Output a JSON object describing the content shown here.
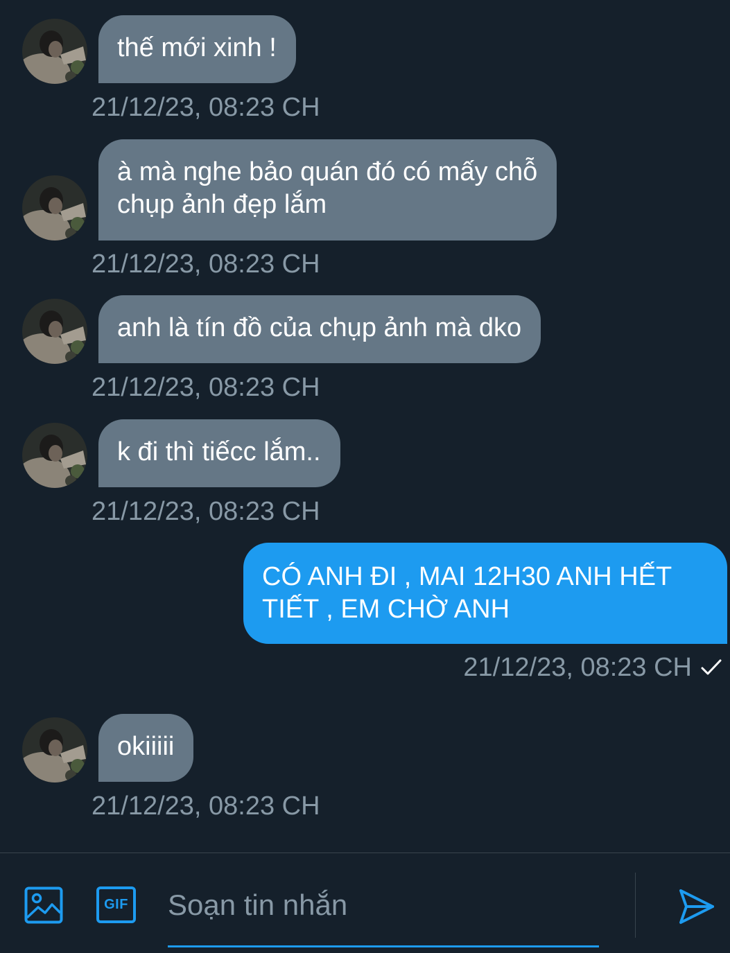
{
  "theme": {
    "background": "#15202b",
    "incoming_bubble": "#657786",
    "outgoing_bubble": "#1d9bf0",
    "timestamp_color": "#8899a6",
    "accent": "#1d9bf0"
  },
  "messages": [
    {
      "direction": "in",
      "text": "thế mới xinh !",
      "timestamp": "21/12/23, 08:23 CH",
      "avatar": "user-avatar"
    },
    {
      "direction": "in",
      "text": "à mà nghe bảo quán đó có mấy chỗ\nchụp ảnh đẹp lắm",
      "timestamp": "21/12/23, 08:23 CH",
      "avatar": "user-avatar"
    },
    {
      "direction": "in",
      "text": "anh là tín đồ của chụp ảnh mà dko",
      "timestamp": "21/12/23, 08:23 CH",
      "avatar": "user-avatar"
    },
    {
      "direction": "in",
      "text": "k đi thì tiếcc lắm..",
      "timestamp": "21/12/23, 08:23 CH",
      "avatar": "user-avatar"
    },
    {
      "direction": "out",
      "text": "CÓ ANH ĐI , MAI 12H30 ANH HẾT\nTIẾT , EM CHỜ ANH",
      "timestamp": "21/12/23, 08:23 CH",
      "status_icon": "check-icon"
    },
    {
      "direction": "in",
      "text": "okiiiii",
      "timestamp": "21/12/23, 08:23 CH",
      "avatar": "user-avatar"
    }
  ],
  "composer": {
    "placeholder": "Soạn tin nhắn",
    "value": "",
    "image_icon": "image-icon",
    "gif_label": "GIF",
    "send_icon": "send-icon"
  }
}
